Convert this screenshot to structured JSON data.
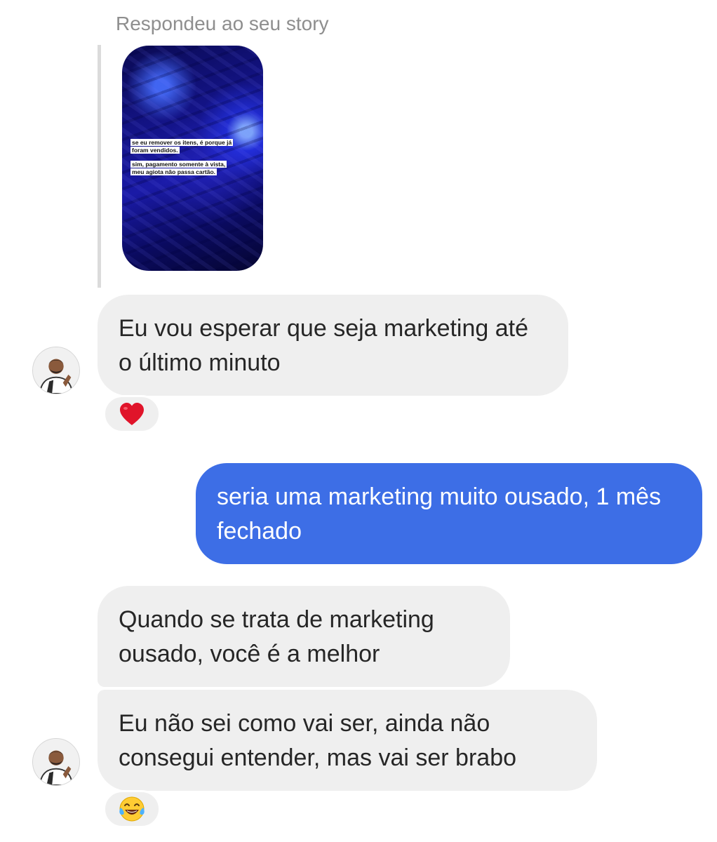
{
  "story_reply": {
    "caption": "Respondeu ao seu story",
    "story_lines": [
      "se eu remover os itens, é porque já foram vendidos.",
      "sim, pagamento somente à vista, meu agiota não passa cartão."
    ]
  },
  "messages": [
    {
      "direction": "incoming",
      "text": "Eu vou esperar que seja marketing até o último minuto",
      "reaction": "heart-icon"
    },
    {
      "direction": "outgoing",
      "text": "seria uma marketing muito ousado, 1 mês fechado"
    },
    {
      "direction": "incoming",
      "text": "Quando se trata de marketing ousado, você é a melhor"
    },
    {
      "direction": "incoming",
      "text": "Eu não sei como vai ser, ainda não consegui entender, mas vai ser brabo",
      "reaction": "laughing-tears-icon"
    }
  ],
  "colors": {
    "outgoing_bubble": "#3d6ee6",
    "incoming_bubble": "#efefef",
    "caption": "#8e8e8e"
  }
}
